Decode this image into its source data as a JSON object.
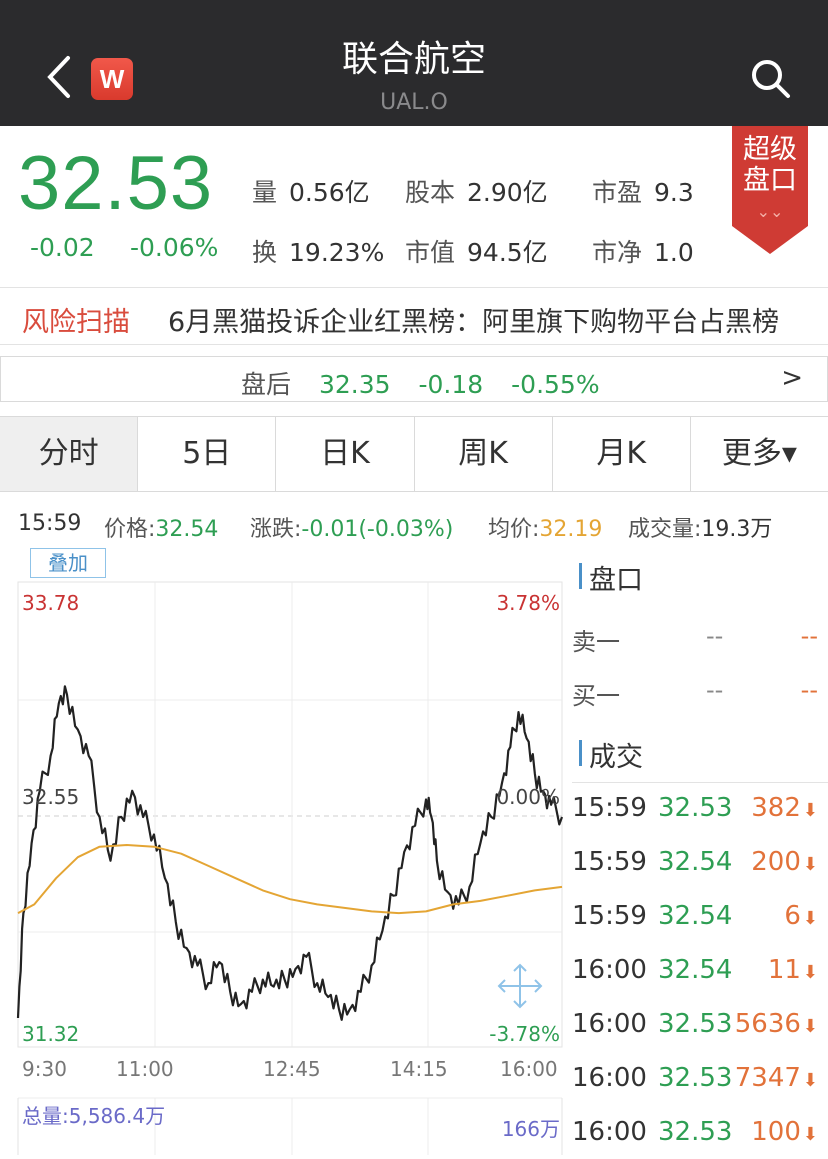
{
  "header": {
    "title": "联合航空",
    "ticker": "UAL.O",
    "logo_letter": "W"
  },
  "quote": {
    "price": "32.53",
    "change": "-0.02",
    "change_pct": "-0.06%",
    "stats": [
      {
        "label": "量",
        "value": "0.56亿"
      },
      {
        "label": "股本",
        "value": "2.90亿"
      },
      {
        "label": "市盈",
        "value": "9.3"
      },
      {
        "label": "换",
        "value": "19.23%"
      },
      {
        "label": "市值",
        "value": "94.5亿"
      },
      {
        "label": "市净",
        "value": "1.0"
      }
    ],
    "badge": {
      "line1": "超级",
      "line2": "盘口",
      "arrow": "⌄⌄"
    }
  },
  "risk": {
    "label": "风险扫描",
    "text": "6月黑猫投诉企业红黑榜：阿里旗下购物平台占黑榜"
  },
  "after_hours": {
    "label": "盘后",
    "price": "32.35",
    "change": "-0.18",
    "change_pct": "-0.55%",
    "arrow": ">"
  },
  "tabs": [
    "分时",
    "5日",
    "日K",
    "周K",
    "月K",
    "更多▾"
  ],
  "info": {
    "time": "15:59",
    "price_label": "价格:",
    "price": "32.54",
    "chg_label": "涨跌:",
    "chg": "-0.01(-0.03%)",
    "avg_label": "均价:",
    "avg": "32.19",
    "vol_label": "成交量:",
    "vol": "19.3万"
  },
  "chart": {
    "overlay_button": "叠加",
    "high_price": "33.78",
    "high_pct": "3.78%",
    "mid_price": "32.55",
    "mid_pct": "0.00%",
    "low_price": "31.32",
    "low_pct": "-3.78%",
    "total_volume": "总量:5,586.4万",
    "max_volume": "166万"
  },
  "chart_data": {
    "type": "line",
    "x_ticks": [
      "9:30",
      "11:00",
      "12:45",
      "14:15",
      "16:00"
    ],
    "ylim": [
      31.32,
      33.78
    ],
    "reference": 32.55,
    "series": [
      {
        "name": "价格",
        "color": "#222222",
        "points": [
          [
            0,
            31.4
          ],
          [
            0.01,
            32.0
          ],
          [
            0.025,
            32.4
          ],
          [
            0.04,
            32.7
          ],
          [
            0.06,
            32.9
          ],
          [
            0.075,
            33.2
          ],
          [
            0.09,
            33.25
          ],
          [
            0.11,
            33.05
          ],
          [
            0.13,
            32.9
          ],
          [
            0.15,
            32.55
          ],
          [
            0.17,
            32.3
          ],
          [
            0.19,
            32.55
          ],
          [
            0.21,
            32.7
          ],
          [
            0.23,
            32.55
          ],
          [
            0.25,
            32.45
          ],
          [
            0.27,
            32.2
          ],
          [
            0.29,
            31.95
          ],
          [
            0.31,
            31.8
          ],
          [
            0.33,
            31.7
          ],
          [
            0.35,
            31.6
          ],
          [
            0.37,
            31.72
          ],
          [
            0.39,
            31.55
          ],
          [
            0.41,
            31.48
          ],
          [
            0.43,
            31.55
          ],
          [
            0.45,
            31.62
          ],
          [
            0.47,
            31.58
          ],
          [
            0.49,
            31.62
          ],
          [
            0.51,
            31.68
          ],
          [
            0.53,
            31.75
          ],
          [
            0.55,
            31.6
          ],
          [
            0.57,
            31.52
          ],
          [
            0.59,
            31.45
          ],
          [
            0.61,
            31.45
          ],
          [
            0.63,
            31.55
          ],
          [
            0.65,
            31.7
          ],
          [
            0.67,
            31.9
          ],
          [
            0.69,
            32.1
          ],
          [
            0.71,
            32.35
          ],
          [
            0.73,
            32.5
          ],
          [
            0.75,
            32.65
          ],
          [
            0.76,
            32.55
          ],
          [
            0.77,
            32.3
          ],
          [
            0.79,
            32.12
          ],
          [
            0.81,
            32.05
          ],
          [
            0.83,
            32.15
          ],
          [
            0.85,
            32.4
          ],
          [
            0.87,
            32.55
          ],
          [
            0.89,
            32.75
          ],
          [
            0.905,
            32.95
          ],
          [
            0.92,
            33.15
          ],
          [
            0.935,
            33.0
          ],
          [
            0.95,
            32.8
          ],
          [
            0.965,
            32.7
          ],
          [
            0.98,
            32.62
          ],
          [
            1.0,
            32.55
          ]
        ]
      },
      {
        "name": "均价",
        "color": "#e4a534",
        "points": [
          [
            0,
            32.0
          ],
          [
            0.03,
            32.05
          ],
          [
            0.07,
            32.2
          ],
          [
            0.11,
            32.32
          ],
          [
            0.15,
            32.38
          ],
          [
            0.2,
            32.39
          ],
          [
            0.25,
            32.38
          ],
          [
            0.3,
            32.34
          ],
          [
            0.35,
            32.27
          ],
          [
            0.4,
            32.2
          ],
          [
            0.45,
            32.13
          ],
          [
            0.5,
            32.08
          ],
          [
            0.55,
            32.05
          ],
          [
            0.6,
            32.03
          ],
          [
            0.65,
            32.01
          ],
          [
            0.7,
            32.0
          ],
          [
            0.75,
            32.01
          ],
          [
            0.8,
            32.05
          ],
          [
            0.85,
            32.07
          ],
          [
            0.9,
            32.1
          ],
          [
            0.95,
            32.13
          ],
          [
            1.0,
            32.15
          ]
        ]
      }
    ]
  },
  "orderbook": {
    "title": "盘口",
    "rows": [
      {
        "label": "卖一",
        "price": "--",
        "vol": "--"
      },
      {
        "label": "买一",
        "price": "--",
        "vol": "--"
      }
    ]
  },
  "trades": {
    "title": "成交",
    "rows": [
      {
        "time": "15:59",
        "price": "32.53",
        "vol": "382"
      },
      {
        "time": "15:59",
        "price": "32.54",
        "vol": "200"
      },
      {
        "time": "15:59",
        "price": "32.54",
        "vol": "6"
      },
      {
        "time": "16:00",
        "price": "32.54",
        "vol": "11"
      },
      {
        "time": "16:00",
        "price": "32.53",
        "vol": "5636"
      },
      {
        "time": "16:00",
        "price": "32.53",
        "vol": "7347"
      },
      {
        "time": "16:00",
        "price": "32.53",
        "vol": "100"
      }
    ]
  }
}
